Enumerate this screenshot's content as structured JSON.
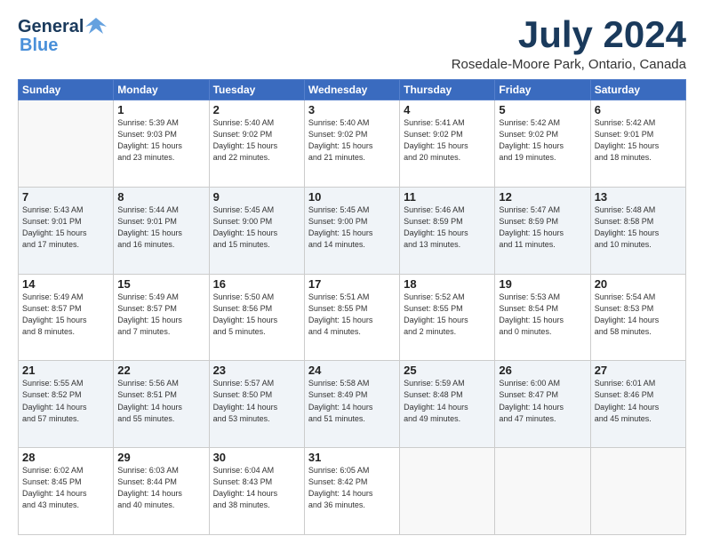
{
  "logo": {
    "line1": "General",
    "line2": "Blue"
  },
  "title": "July 2024",
  "subtitle": "Rosedale-Moore Park, Ontario, Canada",
  "headers": [
    "Sunday",
    "Monday",
    "Tuesday",
    "Wednesday",
    "Thursday",
    "Friday",
    "Saturday"
  ],
  "weeks": [
    [
      {
        "day": "",
        "info": ""
      },
      {
        "day": "1",
        "info": "Sunrise: 5:39 AM\nSunset: 9:03 PM\nDaylight: 15 hours\nand 23 minutes."
      },
      {
        "day": "2",
        "info": "Sunrise: 5:40 AM\nSunset: 9:02 PM\nDaylight: 15 hours\nand 22 minutes."
      },
      {
        "day": "3",
        "info": "Sunrise: 5:40 AM\nSunset: 9:02 PM\nDaylight: 15 hours\nand 21 minutes."
      },
      {
        "day": "4",
        "info": "Sunrise: 5:41 AM\nSunset: 9:02 PM\nDaylight: 15 hours\nand 20 minutes."
      },
      {
        "day": "5",
        "info": "Sunrise: 5:42 AM\nSunset: 9:02 PM\nDaylight: 15 hours\nand 19 minutes."
      },
      {
        "day": "6",
        "info": "Sunrise: 5:42 AM\nSunset: 9:01 PM\nDaylight: 15 hours\nand 18 minutes."
      }
    ],
    [
      {
        "day": "7",
        "info": "Sunrise: 5:43 AM\nSunset: 9:01 PM\nDaylight: 15 hours\nand 17 minutes."
      },
      {
        "day": "8",
        "info": "Sunrise: 5:44 AM\nSunset: 9:01 PM\nDaylight: 15 hours\nand 16 minutes."
      },
      {
        "day": "9",
        "info": "Sunrise: 5:45 AM\nSunset: 9:00 PM\nDaylight: 15 hours\nand 15 minutes."
      },
      {
        "day": "10",
        "info": "Sunrise: 5:45 AM\nSunset: 9:00 PM\nDaylight: 15 hours\nand 14 minutes."
      },
      {
        "day": "11",
        "info": "Sunrise: 5:46 AM\nSunset: 8:59 PM\nDaylight: 15 hours\nand 13 minutes."
      },
      {
        "day": "12",
        "info": "Sunrise: 5:47 AM\nSunset: 8:59 PM\nDaylight: 15 hours\nand 11 minutes."
      },
      {
        "day": "13",
        "info": "Sunrise: 5:48 AM\nSunset: 8:58 PM\nDaylight: 15 hours\nand 10 minutes."
      }
    ],
    [
      {
        "day": "14",
        "info": "Sunrise: 5:49 AM\nSunset: 8:57 PM\nDaylight: 15 hours\nand 8 minutes."
      },
      {
        "day": "15",
        "info": "Sunrise: 5:49 AM\nSunset: 8:57 PM\nDaylight: 15 hours\nand 7 minutes."
      },
      {
        "day": "16",
        "info": "Sunrise: 5:50 AM\nSunset: 8:56 PM\nDaylight: 15 hours\nand 5 minutes."
      },
      {
        "day": "17",
        "info": "Sunrise: 5:51 AM\nSunset: 8:55 PM\nDaylight: 15 hours\nand 4 minutes."
      },
      {
        "day": "18",
        "info": "Sunrise: 5:52 AM\nSunset: 8:55 PM\nDaylight: 15 hours\nand 2 minutes."
      },
      {
        "day": "19",
        "info": "Sunrise: 5:53 AM\nSunset: 8:54 PM\nDaylight: 15 hours\nand 0 minutes."
      },
      {
        "day": "20",
        "info": "Sunrise: 5:54 AM\nSunset: 8:53 PM\nDaylight: 14 hours\nand 58 minutes."
      }
    ],
    [
      {
        "day": "21",
        "info": "Sunrise: 5:55 AM\nSunset: 8:52 PM\nDaylight: 14 hours\nand 57 minutes."
      },
      {
        "day": "22",
        "info": "Sunrise: 5:56 AM\nSunset: 8:51 PM\nDaylight: 14 hours\nand 55 minutes."
      },
      {
        "day": "23",
        "info": "Sunrise: 5:57 AM\nSunset: 8:50 PM\nDaylight: 14 hours\nand 53 minutes."
      },
      {
        "day": "24",
        "info": "Sunrise: 5:58 AM\nSunset: 8:49 PM\nDaylight: 14 hours\nand 51 minutes."
      },
      {
        "day": "25",
        "info": "Sunrise: 5:59 AM\nSunset: 8:48 PM\nDaylight: 14 hours\nand 49 minutes."
      },
      {
        "day": "26",
        "info": "Sunrise: 6:00 AM\nSunset: 8:47 PM\nDaylight: 14 hours\nand 47 minutes."
      },
      {
        "day": "27",
        "info": "Sunrise: 6:01 AM\nSunset: 8:46 PM\nDaylight: 14 hours\nand 45 minutes."
      }
    ],
    [
      {
        "day": "28",
        "info": "Sunrise: 6:02 AM\nSunset: 8:45 PM\nDaylight: 14 hours\nand 43 minutes."
      },
      {
        "day": "29",
        "info": "Sunrise: 6:03 AM\nSunset: 8:44 PM\nDaylight: 14 hours\nand 40 minutes."
      },
      {
        "day": "30",
        "info": "Sunrise: 6:04 AM\nSunset: 8:43 PM\nDaylight: 14 hours\nand 38 minutes."
      },
      {
        "day": "31",
        "info": "Sunrise: 6:05 AM\nSunset: 8:42 PM\nDaylight: 14 hours\nand 36 minutes."
      },
      {
        "day": "",
        "info": ""
      },
      {
        "day": "",
        "info": ""
      },
      {
        "day": "",
        "info": ""
      }
    ]
  ]
}
